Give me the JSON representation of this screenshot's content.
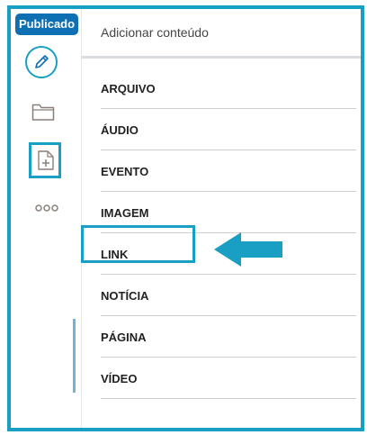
{
  "status_badge": "Publicado",
  "panel": {
    "title": "Adicionar conteúdo"
  },
  "menu": [
    {
      "label": "ARQUIVO"
    },
    {
      "label": "ÁUDIO"
    },
    {
      "label": "EVENTO"
    },
    {
      "label": "IMAGEM"
    },
    {
      "label": "LINK"
    },
    {
      "label": "NOTÍCIA"
    },
    {
      "label": "PÁGINA"
    },
    {
      "label": "VÍDEO"
    }
  ],
  "highlight_target": "LINK",
  "icons": {
    "edit": "pencil-icon",
    "folder": "folder-icon",
    "add_content": "add-document-icon",
    "more": "more-dots-icon"
  },
  "colors": {
    "accent": "#1a9fc4",
    "badge": "#0f6fb3",
    "icon_gray": "#8a7f7a"
  }
}
